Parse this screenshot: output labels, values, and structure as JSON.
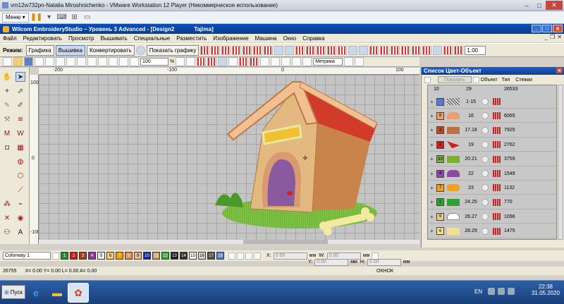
{
  "vm": {
    "title": "vm12w732pn-Natalia Miroshnichenko - VMware Workstation 12 Player (Некоммерческое использование)",
    "menu_label": "Меню"
  },
  "app": {
    "title": "Wilcom EmbroideryStudio – Уровень 3 Advanced - [Design2",
    "title_suffix": "Tajima]"
  },
  "menubar": [
    "Файл",
    "Редактировать",
    "Просмотр",
    "Вышивать",
    "Специальные",
    "Разместить",
    "Изображение",
    "Машина",
    "Окно",
    "Справка"
  ],
  "toolbar": {
    "mode_label": "Режим:",
    "btn_graphics": "Графика",
    "btn_embroidery": "Вышивка",
    "btn_convert": "Конвертировать",
    "btn_show_graphics": "Показать графику",
    "zoom_value": "1.00"
  },
  "toolbar2": {
    "zoom": "100",
    "percent": "%",
    "units": "Метрика"
  },
  "ruler": {
    "h_labels": [
      "-200",
      "-100",
      "0",
      "100"
    ],
    "v_labels": [
      "100",
      "0",
      "-100"
    ]
  },
  "panel": {
    "title": "Список Цвет-Объект",
    "show_button": "Показать",
    "col_object": "Объект",
    "col_type": "Тип",
    "col_stitches": "Стежки",
    "summary": {
      "count": "10",
      "objects": "29",
      "stitches": "26533"
    },
    "rows": [
      {
        "chip": "",
        "chip_color": "#5a7ad0",
        "objects": "1-15",
        "stitches": ""
      },
      {
        "chip": "8",
        "chip_color": "#e8a070",
        "objects": "16",
        "stitches": "6065"
      },
      {
        "chip": "3",
        "chip_color": "#b05030",
        "objects": "17.18",
        "stitches": "7925"
      },
      {
        "chip": "2",
        "chip_color": "#d02020",
        "objects": "19",
        "stitches": "2762"
      },
      {
        "chip": "33",
        "chip_color": "#7ab030",
        "objects": "20.21",
        "stitches": "3759"
      },
      {
        "chip": "4",
        "chip_color": "#8a4aa0",
        "objects": "22",
        "stitches": "1549"
      },
      {
        "chip": "7",
        "chip_color": "#f0a020",
        "objects": "23",
        "stitches": "1132"
      },
      {
        "chip": "1",
        "chip_color": "#30a030",
        "objects": "24.25",
        "stitches": "770"
      },
      {
        "chip": "9",
        "chip_color": "#e8c890",
        "objects": "26.27",
        "stitches": "1096"
      },
      {
        "chip": "6",
        "chip_color": "#f0e090",
        "objects": "28.29",
        "stitches": "1475"
      }
    ]
  },
  "palette": {
    "colorway": "Colorway 1",
    "swatches": [
      {
        "n": "1",
        "c": "#2a8a30"
      },
      {
        "n": "2",
        "c": "#c02020"
      },
      {
        "n": "3",
        "c": "#a04020"
      },
      {
        "n": "4",
        "c": "#8a3a90"
      },
      {
        "n": "5",
        "c": "#f0f0f0"
      },
      {
        "n": "6",
        "c": "#f0d080"
      },
      {
        "n": "7",
        "c": "#f0a000"
      },
      {
        "n": "8",
        "c": "#e09060"
      },
      {
        "n": "9",
        "c": "#e8c080"
      },
      {
        "n": "10",
        "c": "#1a2a8a"
      },
      {
        "n": "11",
        "c": "#d0a070"
      },
      {
        "n": "12",
        "c": "#40a040"
      },
      {
        "n": "13",
        "c": "#202020"
      },
      {
        "n": "14",
        "c": "#303030"
      },
      {
        "n": "15",
        "c": "#ffffff"
      },
      {
        "n": "16",
        "c": "#d8d8d8"
      },
      {
        "n": "17",
        "c": "#505050"
      },
      {
        "n": "18",
        "c": "#6080c0"
      }
    ],
    "x_label": "X:",
    "y_label": "Y:",
    "w_label": "W:",
    "h_label": "H:",
    "x_value": "0.00",
    "y_value": "0.00",
    "w_value": "0.00",
    "h_value": "0.00",
    "unit": "мм"
  },
  "status": {
    "stitch_count": "26755",
    "coords": "X=   0.00 Y=   0.00 L=   0.00 A=   0.00",
    "center": "ОКНОК"
  },
  "taskbar": {
    "start": "Пуск",
    "lang": "EN",
    "time": "22:38",
    "date": "31.05.2020"
  },
  "colors": {
    "accent": "#0a4fb8",
    "canvas": "#c4c4c4",
    "roof": "#d23a2a",
    "wall": "#e8c08a",
    "grass": "#7ac040"
  }
}
